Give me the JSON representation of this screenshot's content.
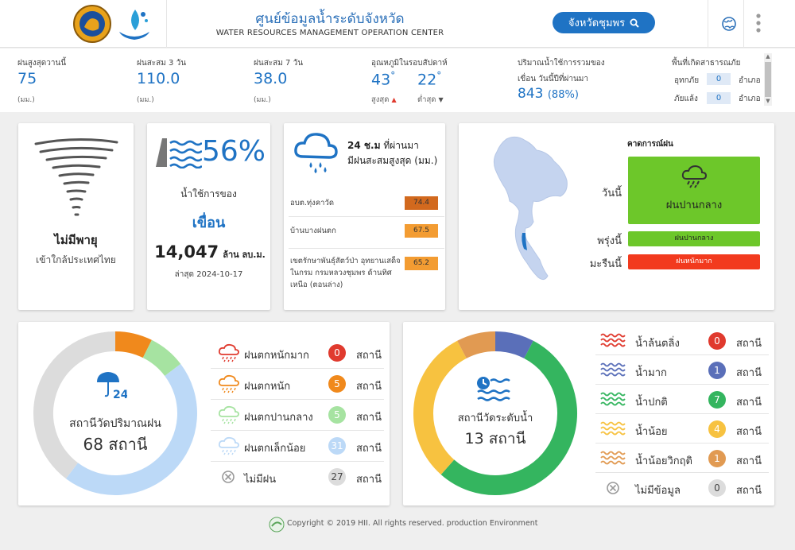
{
  "header": {
    "title_th": "ศูนย์ข้อมูลน้ำระดับจังหวัด",
    "title_en": "WATER RESOURCES MANAGEMENT OPERATION CENTER",
    "province_button": "จังหวัดชุมพร"
  },
  "stats": {
    "rain_today": {
      "label": "ฝนสูงสุดวานนี้",
      "value": "75",
      "unit": "(มม.)"
    },
    "rain_3d": {
      "label": "ฝนสะสม 3 วัน",
      "value": "110.0",
      "unit": "(มม.)"
    },
    "rain_7d": {
      "label": "ฝนสะสม 7 วัน",
      "value": "38.0",
      "unit": "(มม.)"
    },
    "temp": {
      "label": "อุณหภูมิในรอบสัปดาห์",
      "max": "43",
      "min": "22",
      "deg": "°",
      "max_label": "สูงสุด",
      "min_label": "ต่ำสุด"
    },
    "storage": {
      "label_line1": "ปริมาณน้ำใช้การรวมของ",
      "label_line2": "เขื่อน วันนี้ปีที่ผ่านมา",
      "value": "843",
      "percent": "(88%)"
    },
    "disaster": {
      "label": "พื้นที่เกิดสาธารณภัย",
      "flood_label": "อุทกภัย",
      "flood_value": "0",
      "drought_label": "ภัยแล้ง",
      "drought_value": "0",
      "unit": "อำเภอ"
    }
  },
  "storm": {
    "title": "ไม่มีพายุ",
    "subtitle": "เข้าใกล้ประเทศไทย"
  },
  "dam": {
    "percent": "56%",
    "label1": "น้ำใช้การของ",
    "label2": "เขื่อน",
    "volume": "14,047",
    "volume_unit": "ล้าน ลบ.ม.",
    "updated": "ล่าสุด 2024-10-17"
  },
  "rain24": {
    "title_bold": "24 ช.ม",
    "title_rest": " ที่ผ่านมา",
    "subtitle": "มีฝนสะสมสูงสุด (มม.)",
    "rows": [
      {
        "name": "อบต.ทุ่งคาวัด",
        "value": "74.4",
        "color": "#d2691e"
      },
      {
        "name": "บ้านบางฝนตก",
        "value": "67.5",
        "color": "#f39c32"
      },
      {
        "name": "เขตรักษาพันธุ์สัตว์ป่า อุทยานเสด็จในกรม กรมหลวงชุมพร ด้านทิศเหนือ (ตอนล่าง)",
        "value": "65.2",
        "color": "#f39c32"
      }
    ]
  },
  "forecast": {
    "title": "คาดการณ์ฝน",
    "today_label": "วันนี้",
    "today_value": "ฝนปานกลาง",
    "today_color": "#6dc72a",
    "tomorrow_label": "พรุ่งนี้",
    "tomorrow_value": "ฝนปานกลาง",
    "tomorrow_color": "#6dc72a",
    "dayafter_label": "มะรืนนี้",
    "dayafter_value": "ฝนหนักมาก",
    "dayafter_color": "#f23a1e"
  },
  "rain_stations": {
    "center_label": "สถานีวัดปริมาณฝน",
    "center_value": "68 สถานี",
    "items": [
      {
        "label": "ฝนตกหนักมาก",
        "count": "0",
        "unit": "สถานี",
        "color": "#e03a2e",
        "icon": "cloud-heavy-rain-icon"
      },
      {
        "label": "ฝนตกหนัก",
        "count": "5",
        "unit": "สถานี",
        "color": "#f0891c",
        "icon": "cloud-rain-icon"
      },
      {
        "label": "ฝนตกปานกลาง",
        "count": "5",
        "unit": "สถานี",
        "color": "#a6e3a1",
        "icon": "cloud-moderate-rain-icon"
      },
      {
        "label": "ฝนตกเล็กน้อย",
        "count": "31",
        "unit": "สถานี",
        "color": "#bcd9f7",
        "icon": "cloud-light-rain-icon"
      },
      {
        "label": "ไม่มีฝน",
        "count": "27",
        "unit": "สถานี",
        "color": "#dcdcdc",
        "icon": "no-rain-icon"
      }
    ]
  },
  "water_stations": {
    "center_label": "สถานีวัดระดับน้ำ",
    "center_value": "13 สถานี",
    "items": [
      {
        "label": "น้ำล้นตลิ่ง",
        "count": "0",
        "unit": "สถานี",
        "color": "#e03a2e",
        "icon": "wave-overflow-icon"
      },
      {
        "label": "น้ำมาก",
        "count": "1",
        "unit": "สถานี",
        "color": "#5a6fb9",
        "icon": "wave-high-icon"
      },
      {
        "label": "น้ำปกติ",
        "count": "7",
        "unit": "สถานี",
        "color": "#34b55f",
        "icon": "wave-normal-icon"
      },
      {
        "label": "น้ำน้อย",
        "count": "4",
        "unit": "สถานี",
        "color": "#f7c240",
        "icon": "wave-low-icon"
      },
      {
        "label": "น้ำน้อยวิกฤติ",
        "count": "1",
        "unit": "สถานี",
        "color": "#e19a52",
        "icon": "wave-critical-icon"
      },
      {
        "label": "ไม่มีข้อมูล",
        "count": "0",
        "unit": "สถานี",
        "color": "#dcdcdc",
        "icon": "no-data-icon"
      }
    ]
  },
  "footer": {
    "copyright": "Copyright © 2019 HII. All rights reserved. production Environment"
  }
}
